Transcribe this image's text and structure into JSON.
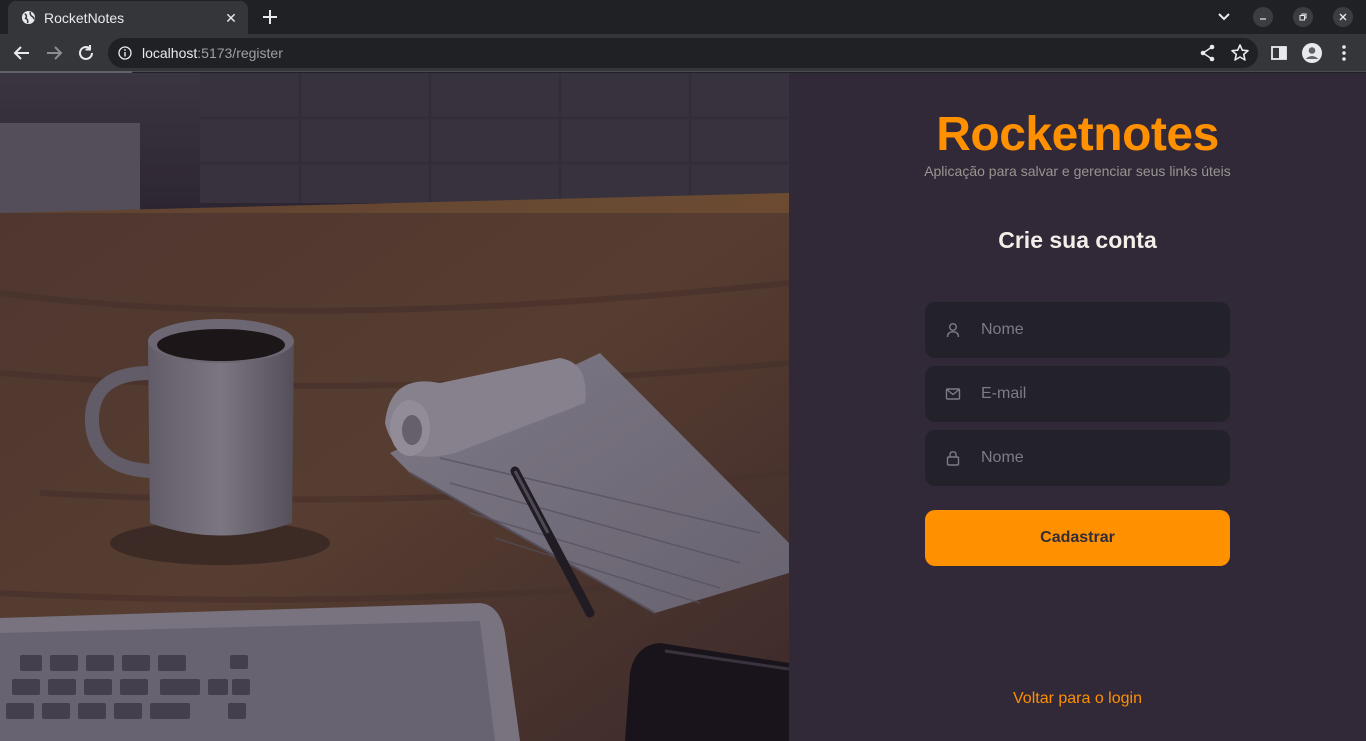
{
  "browser": {
    "tab_title": "RocketNotes",
    "url_host": "localhost",
    "url_rest": ":5173/register"
  },
  "page": {
    "brand": "Rocketnotes",
    "subtitle": "Aplicação para salvar e gerenciar seus links úteis",
    "form_title": "Crie sua conta",
    "fields": [
      {
        "icon": "user-icon",
        "placeholder": "Nome"
      },
      {
        "icon": "mail-icon",
        "placeholder": "E-mail"
      },
      {
        "icon": "lock-icon",
        "placeholder": "Nome"
      }
    ],
    "submit_label": "Cadastrar",
    "back_link": "Voltar para o login"
  },
  "colors": {
    "accent": "#ff9000",
    "panel_bg": "#312838",
    "input_bg": "#232129",
    "title_text": "#f4ede8",
    "muted_text": "#999591"
  }
}
